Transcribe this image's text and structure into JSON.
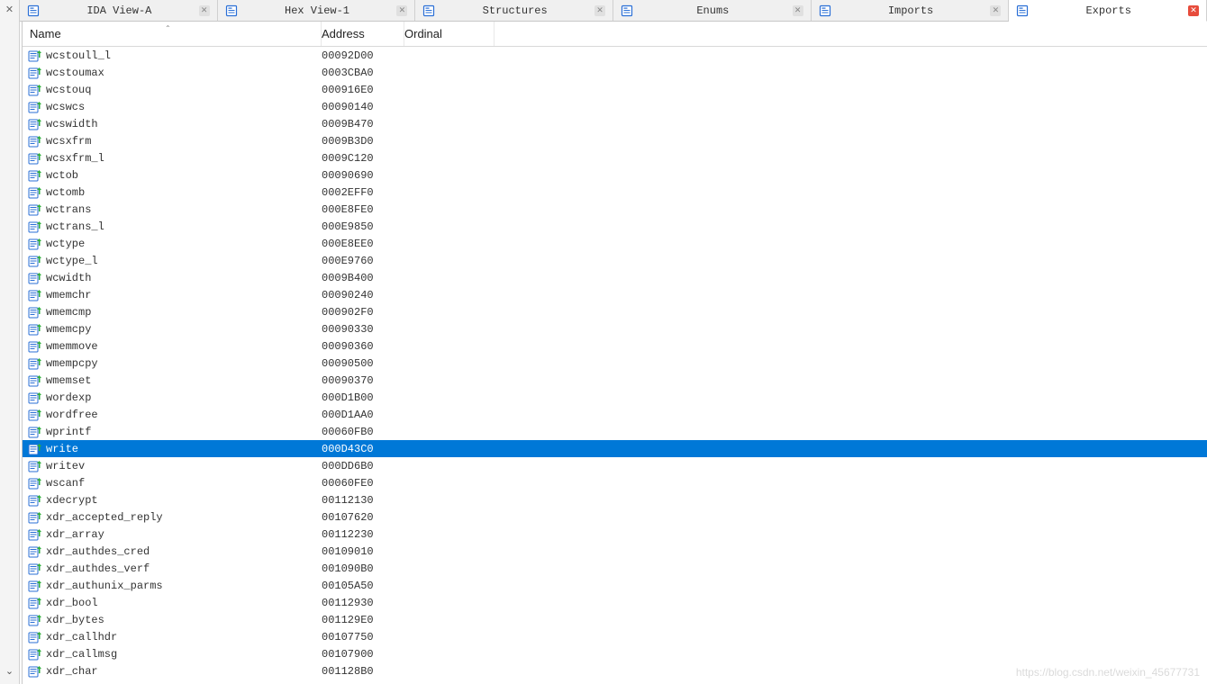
{
  "tabs": [
    {
      "label": "IDA View-A",
      "iconColor": "#2a6fd6",
      "closeColor": "gray"
    },
    {
      "label": "Hex View-1",
      "iconColor": "#2a6fd6",
      "closeColor": "gray"
    },
    {
      "label": "Structures",
      "iconColor": "#2a6fd6",
      "closeColor": "gray"
    },
    {
      "label": "Enums",
      "iconColor": "#2a6fd6",
      "closeColor": "gray"
    },
    {
      "label": "Imports",
      "iconColor": "#2a6fd6",
      "closeColor": "gray"
    },
    {
      "label": "Exports",
      "iconColor": "#2a6fd6",
      "closeColor": "red",
      "active": true
    }
  ],
  "columns": {
    "name": "Name",
    "address": "Address",
    "ordinal": "Ordinal"
  },
  "selectedRow": "write",
  "rows": [
    {
      "name": "wcstoull_l",
      "address": "00092D00"
    },
    {
      "name": "wcstoumax",
      "address": "0003CBA0"
    },
    {
      "name": "wcstouq",
      "address": "000916E0"
    },
    {
      "name": "wcswcs",
      "address": "00090140"
    },
    {
      "name": "wcswidth",
      "address": "0009B470"
    },
    {
      "name": "wcsxfrm",
      "address": "0009B3D0"
    },
    {
      "name": "wcsxfrm_l",
      "address": "0009C120"
    },
    {
      "name": "wctob",
      "address": "00090690"
    },
    {
      "name": "wctomb",
      "address": "0002EFF0"
    },
    {
      "name": "wctrans",
      "address": "000E8FE0"
    },
    {
      "name": "wctrans_l",
      "address": "000E9850"
    },
    {
      "name": "wctype",
      "address": "000E8EE0"
    },
    {
      "name": "wctype_l",
      "address": "000E9760"
    },
    {
      "name": "wcwidth",
      "address": "0009B400"
    },
    {
      "name": "wmemchr",
      "address": "00090240"
    },
    {
      "name": "wmemcmp",
      "address": "000902F0"
    },
    {
      "name": "wmemcpy",
      "address": "00090330"
    },
    {
      "name": "wmemmove",
      "address": "00090360"
    },
    {
      "name": "wmempcpy",
      "address": "00090500"
    },
    {
      "name": "wmemset",
      "address": "00090370"
    },
    {
      "name": "wordexp",
      "address": "000D1B00"
    },
    {
      "name": "wordfree",
      "address": "000D1AA0"
    },
    {
      "name": "wprintf",
      "address": "00060FB0"
    },
    {
      "name": "write",
      "address": "000D43C0"
    },
    {
      "name": "writev",
      "address": "000DD6B0"
    },
    {
      "name": "wscanf",
      "address": "00060FE0"
    },
    {
      "name": "xdecrypt",
      "address": "00112130"
    },
    {
      "name": "xdr_accepted_reply",
      "address": "00107620"
    },
    {
      "name": "xdr_array",
      "address": "00112230"
    },
    {
      "name": "xdr_authdes_cred",
      "address": "00109010"
    },
    {
      "name": "xdr_authdes_verf",
      "address": "001090B0"
    },
    {
      "name": "xdr_authunix_parms",
      "address": "00105A50"
    },
    {
      "name": "xdr_bool",
      "address": "00112930"
    },
    {
      "name": "xdr_bytes",
      "address": "001129E0"
    },
    {
      "name": "xdr_callhdr",
      "address": "00107750"
    },
    {
      "name": "xdr_callmsg",
      "address": "00107900"
    },
    {
      "name": "xdr_char",
      "address": "001128B0"
    }
  ],
  "watermark": "https://blog.csdn.net/weixin_45677731",
  "gutter": {
    "close_glyph": "✕",
    "down_glyph": "⌄"
  }
}
